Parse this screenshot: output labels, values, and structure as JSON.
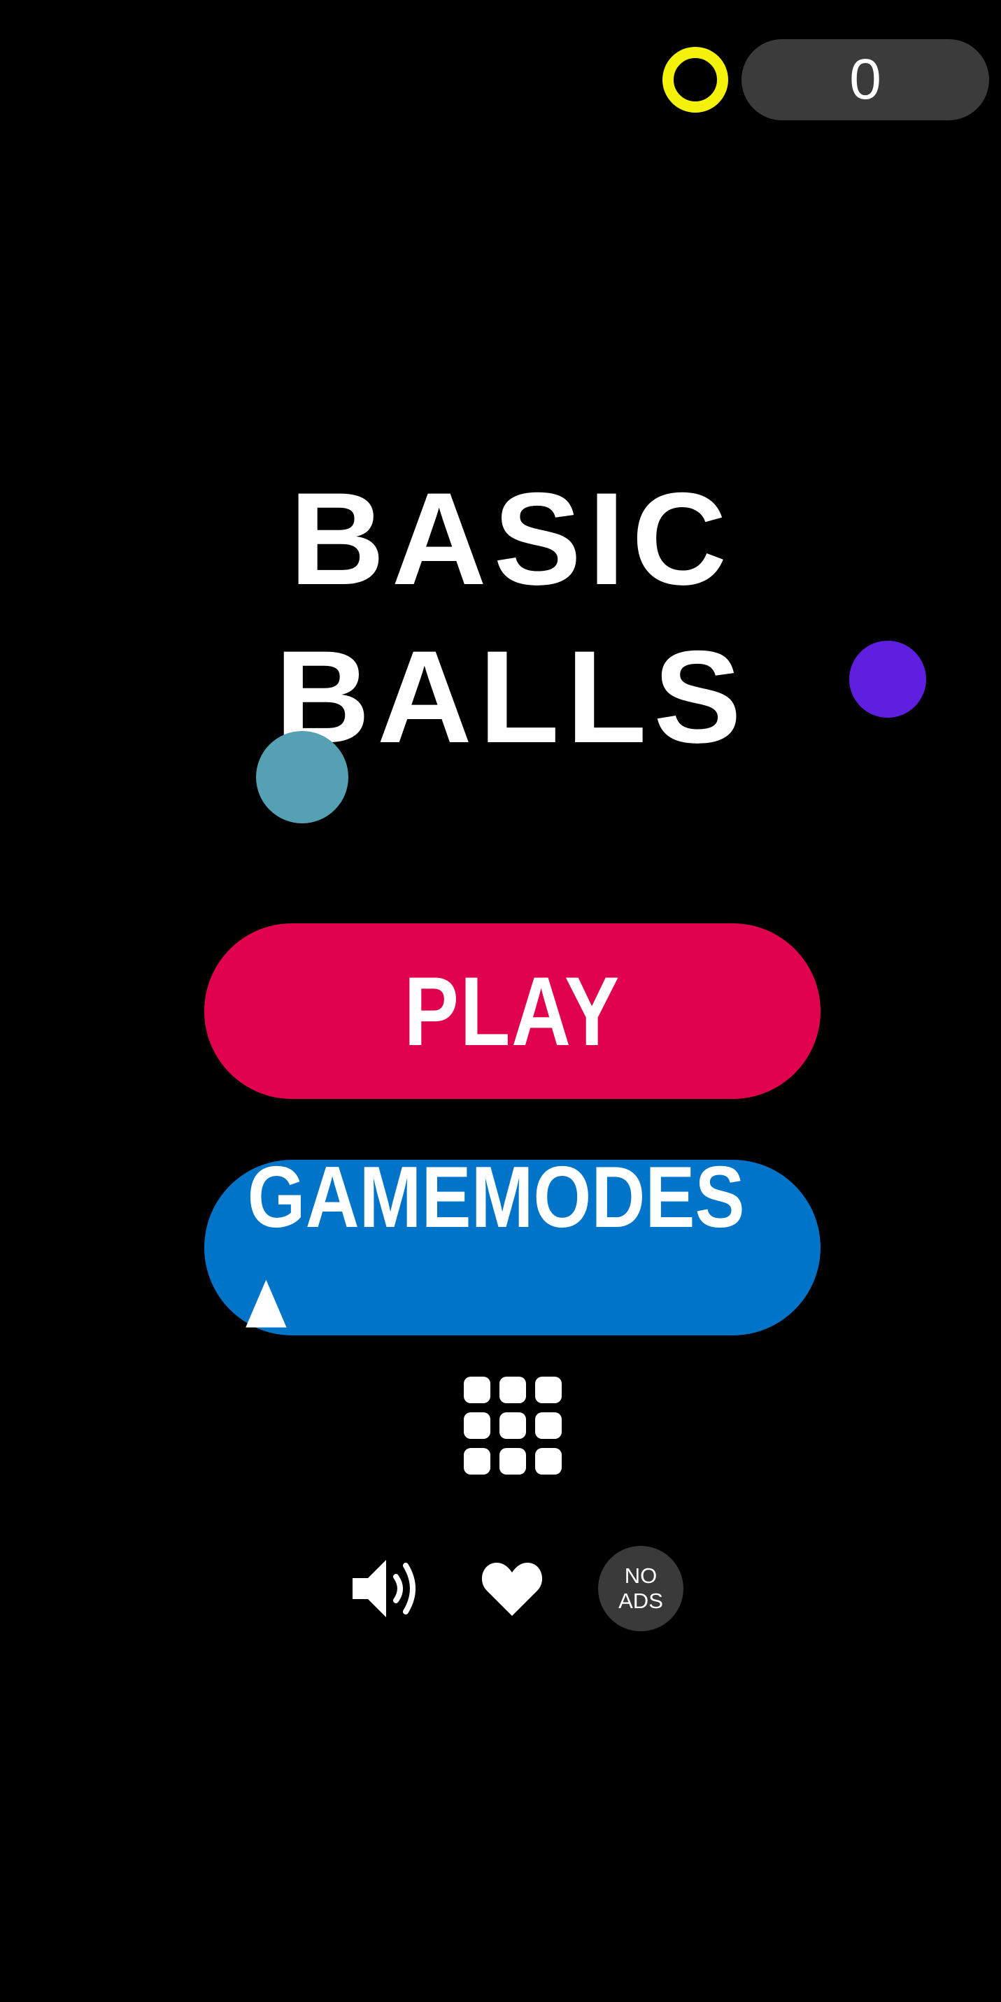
{
  "header": {
    "coin_icon": "coin-ring-icon",
    "coin_color": "#f4f10a",
    "score": "0"
  },
  "title": {
    "line1": "BASIC",
    "line2": "BALLS"
  },
  "decor": {
    "ball_colors": [
      "#5f1fe0",
      "#56a0b4"
    ]
  },
  "buttons": {
    "play": {
      "label": "PLAY",
      "color": "#e0024f"
    },
    "gamemodes": {
      "label": "GAMEMODES ▴",
      "color": "#0074c8"
    }
  },
  "icons": {
    "menu": "grid-icon",
    "sound": "speaker-icon",
    "like": "heart-icon"
  },
  "noads": {
    "line1": "NO",
    "line2": "ADS"
  }
}
